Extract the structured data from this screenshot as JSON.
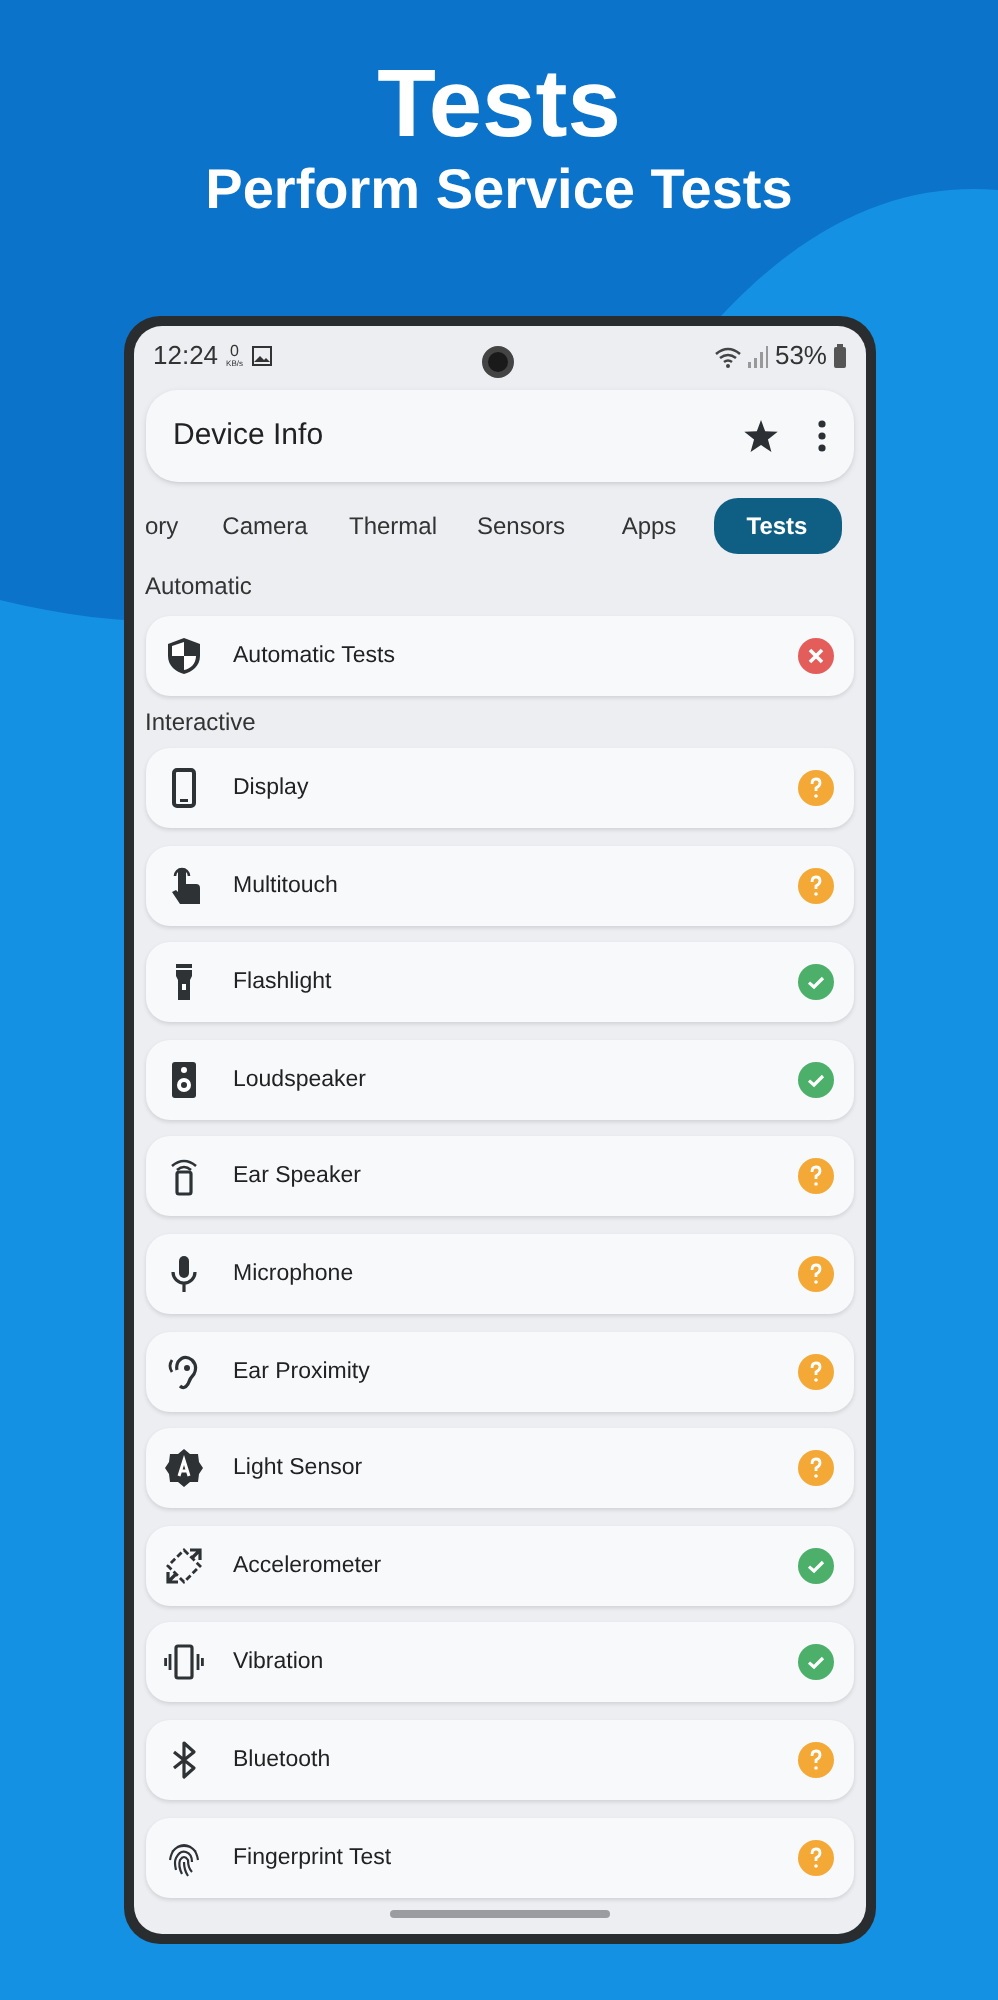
{
  "header": {
    "title": "Tests",
    "subtitle": "Perform Service Tests"
  },
  "status_bar": {
    "time": "12:24",
    "speed": "0",
    "speed_unit": "KB/s",
    "battery": "53%"
  },
  "app_bar": {
    "title": "Device Info"
  },
  "tabs": [
    {
      "label": "ory",
      "selected": false
    },
    {
      "label": "Camera",
      "selected": false
    },
    {
      "label": "Thermal",
      "selected": false
    },
    {
      "label": "Sensors",
      "selected": false
    },
    {
      "label": "Apps",
      "selected": false
    },
    {
      "label": "Tests",
      "selected": true
    }
  ],
  "sections": [
    {
      "title": "Automatic",
      "items": [
        {
          "label": "Automatic Tests",
          "kind": "fail"
        }
      ]
    },
    {
      "title": "Interactive",
      "items": [
        {
          "label": "Display",
          "kind": "unknown"
        },
        {
          "label": "Multitouch",
          "kind": "unknown"
        },
        {
          "label": "Flashlight",
          "kind": "pass"
        },
        {
          "label": "Loudspeaker",
          "kind": "pass"
        },
        {
          "label": "Ear Speaker",
          "kind": "unknown"
        },
        {
          "label": "Microphone",
          "kind": "unknown"
        },
        {
          "label": "Ear Proximity",
          "kind": "unknown"
        },
        {
          "label": "Light Sensor",
          "kind": "unknown"
        },
        {
          "label": "Accelerometer",
          "kind": "pass"
        },
        {
          "label": "Vibration",
          "kind": "pass"
        },
        {
          "label": "Bluetooth",
          "kind": "unknown"
        },
        {
          "label": "Fingerprint Test",
          "kind": "unknown"
        }
      ]
    }
  ]
}
